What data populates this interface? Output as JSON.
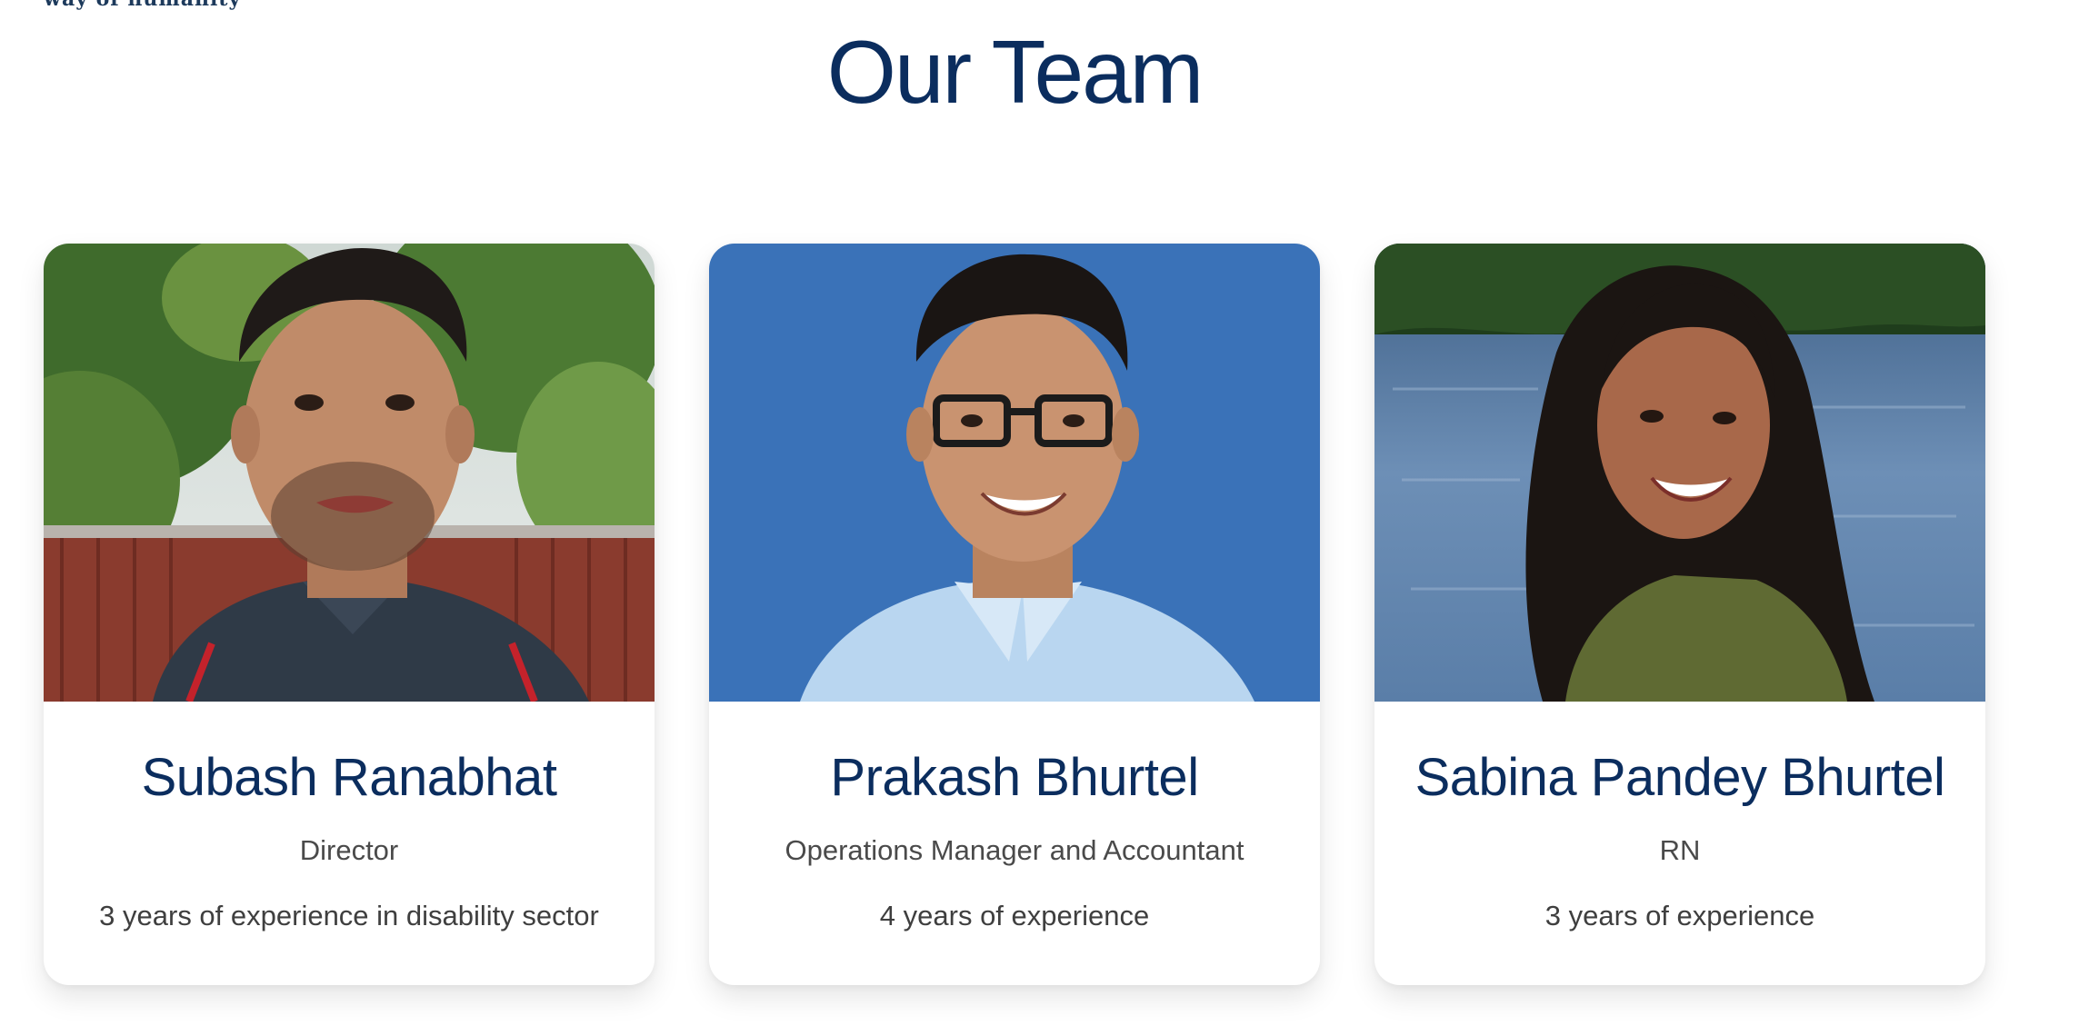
{
  "header": {
    "tagline": "way of humanity"
  },
  "section": {
    "title": "Our Team"
  },
  "team": [
    {
      "name": "Subash Ranabhat",
      "role": "Director",
      "experience": "3 years of experience in disability sector",
      "photo_icon": "portrait-photo-man-outdoors"
    },
    {
      "name": "Prakash Bhurtel",
      "role": "Operations Manager and Accountant",
      "experience": "4 years of experience",
      "photo_icon": "portrait-photo-man-blue-background"
    },
    {
      "name": "Sabina Pandey Bhurtel",
      "role": "RN",
      "experience": "3 years of experience",
      "photo_icon": "portrait-photo-woman-lake"
    }
  ],
  "colors": {
    "title": "#0b2d5e",
    "text": "#4a4a4a",
    "card_bg": "#ffffff",
    "photo2_bg": "#3a72b8"
  }
}
